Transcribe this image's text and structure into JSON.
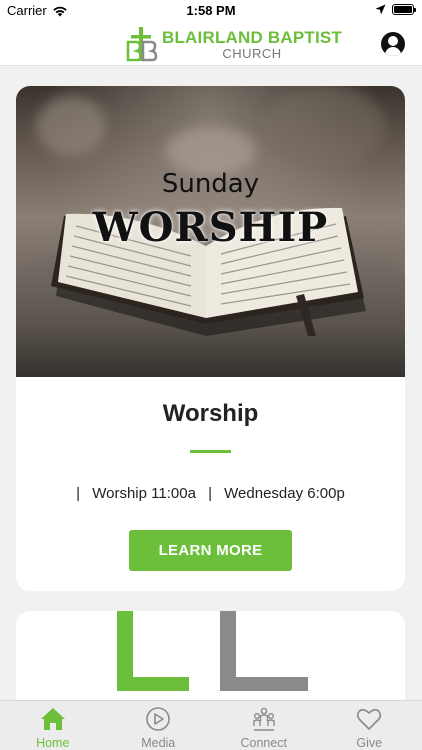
{
  "status_bar": {
    "carrier": "Carrier",
    "time": "1:58 PM"
  },
  "header": {
    "logo_title": "BLAIRLAND BAPTIST",
    "logo_subtitle": "CHURCH",
    "account_icon": "account-circle-icon"
  },
  "cards": [
    {
      "image_text_small": "Sunday",
      "image_text_large": "WORSHIP",
      "title": "Worship",
      "schedule_sep": "|",
      "schedule_item_1": "Worship 11:00a",
      "schedule_item_2": "Wednesday 6:00p",
      "button_label": "LEARN MORE"
    }
  ],
  "tabs": [
    {
      "label": "Home",
      "icon": "home-icon",
      "active": true
    },
    {
      "label": "Media",
      "icon": "play-circle-icon",
      "active": false
    },
    {
      "label": "Connect",
      "icon": "people-icon",
      "active": false
    },
    {
      "label": "Give",
      "icon": "heart-icon",
      "active": false
    }
  ],
  "colors": {
    "accent": "#6cbf3a",
    "inactive": "#8a8a8a",
    "background": "#f1f1f1"
  }
}
